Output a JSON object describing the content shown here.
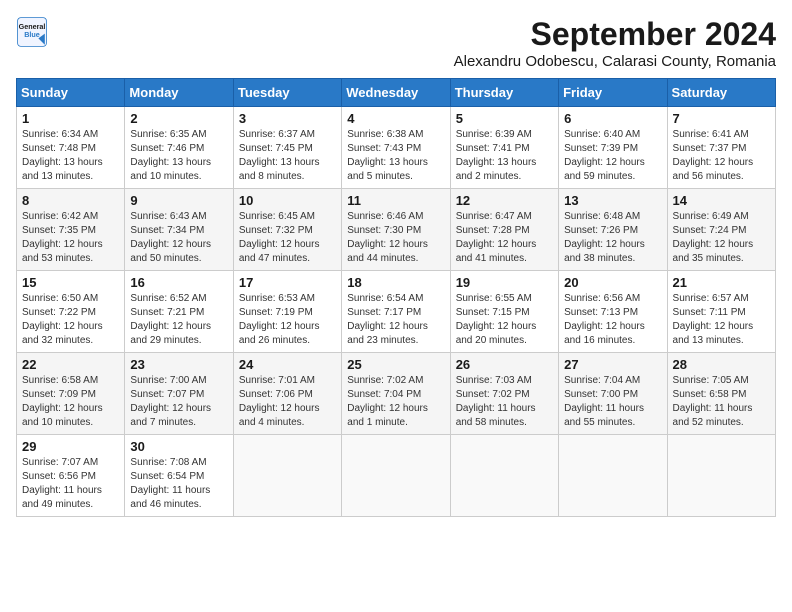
{
  "logo": {
    "line1": "General",
    "line2": "Blue"
  },
  "title": "September 2024",
  "subtitle": "Alexandru Odobescu, Calarasi County, Romania",
  "days_of_week": [
    "Sunday",
    "Monday",
    "Tuesday",
    "Wednesday",
    "Thursday",
    "Friday",
    "Saturday"
  ],
  "weeks": [
    [
      {
        "day": "1",
        "info": "Sunrise: 6:34 AM\nSunset: 7:48 PM\nDaylight: 13 hours\nand 13 minutes."
      },
      {
        "day": "2",
        "info": "Sunrise: 6:35 AM\nSunset: 7:46 PM\nDaylight: 13 hours\nand 10 minutes."
      },
      {
        "day": "3",
        "info": "Sunrise: 6:37 AM\nSunset: 7:45 PM\nDaylight: 13 hours\nand 8 minutes."
      },
      {
        "day": "4",
        "info": "Sunrise: 6:38 AM\nSunset: 7:43 PM\nDaylight: 13 hours\nand 5 minutes."
      },
      {
        "day": "5",
        "info": "Sunrise: 6:39 AM\nSunset: 7:41 PM\nDaylight: 13 hours\nand 2 minutes."
      },
      {
        "day": "6",
        "info": "Sunrise: 6:40 AM\nSunset: 7:39 PM\nDaylight: 12 hours\nand 59 minutes."
      },
      {
        "day": "7",
        "info": "Sunrise: 6:41 AM\nSunset: 7:37 PM\nDaylight: 12 hours\nand 56 minutes."
      }
    ],
    [
      {
        "day": "8",
        "info": "Sunrise: 6:42 AM\nSunset: 7:35 PM\nDaylight: 12 hours\nand 53 minutes."
      },
      {
        "day": "9",
        "info": "Sunrise: 6:43 AM\nSunset: 7:34 PM\nDaylight: 12 hours\nand 50 minutes."
      },
      {
        "day": "10",
        "info": "Sunrise: 6:45 AM\nSunset: 7:32 PM\nDaylight: 12 hours\nand 47 minutes."
      },
      {
        "day": "11",
        "info": "Sunrise: 6:46 AM\nSunset: 7:30 PM\nDaylight: 12 hours\nand 44 minutes."
      },
      {
        "day": "12",
        "info": "Sunrise: 6:47 AM\nSunset: 7:28 PM\nDaylight: 12 hours\nand 41 minutes."
      },
      {
        "day": "13",
        "info": "Sunrise: 6:48 AM\nSunset: 7:26 PM\nDaylight: 12 hours\nand 38 minutes."
      },
      {
        "day": "14",
        "info": "Sunrise: 6:49 AM\nSunset: 7:24 PM\nDaylight: 12 hours\nand 35 minutes."
      }
    ],
    [
      {
        "day": "15",
        "info": "Sunrise: 6:50 AM\nSunset: 7:22 PM\nDaylight: 12 hours\nand 32 minutes."
      },
      {
        "day": "16",
        "info": "Sunrise: 6:52 AM\nSunset: 7:21 PM\nDaylight: 12 hours\nand 29 minutes."
      },
      {
        "day": "17",
        "info": "Sunrise: 6:53 AM\nSunset: 7:19 PM\nDaylight: 12 hours\nand 26 minutes."
      },
      {
        "day": "18",
        "info": "Sunrise: 6:54 AM\nSunset: 7:17 PM\nDaylight: 12 hours\nand 23 minutes."
      },
      {
        "day": "19",
        "info": "Sunrise: 6:55 AM\nSunset: 7:15 PM\nDaylight: 12 hours\nand 20 minutes."
      },
      {
        "day": "20",
        "info": "Sunrise: 6:56 AM\nSunset: 7:13 PM\nDaylight: 12 hours\nand 16 minutes."
      },
      {
        "day": "21",
        "info": "Sunrise: 6:57 AM\nSunset: 7:11 PM\nDaylight: 12 hours\nand 13 minutes."
      }
    ],
    [
      {
        "day": "22",
        "info": "Sunrise: 6:58 AM\nSunset: 7:09 PM\nDaylight: 12 hours\nand 10 minutes."
      },
      {
        "day": "23",
        "info": "Sunrise: 7:00 AM\nSunset: 7:07 PM\nDaylight: 12 hours\nand 7 minutes."
      },
      {
        "day": "24",
        "info": "Sunrise: 7:01 AM\nSunset: 7:06 PM\nDaylight: 12 hours\nand 4 minutes."
      },
      {
        "day": "25",
        "info": "Sunrise: 7:02 AM\nSunset: 7:04 PM\nDaylight: 12 hours\nand 1 minute."
      },
      {
        "day": "26",
        "info": "Sunrise: 7:03 AM\nSunset: 7:02 PM\nDaylight: 11 hours\nand 58 minutes."
      },
      {
        "day": "27",
        "info": "Sunrise: 7:04 AM\nSunset: 7:00 PM\nDaylight: 11 hours\nand 55 minutes."
      },
      {
        "day": "28",
        "info": "Sunrise: 7:05 AM\nSunset: 6:58 PM\nDaylight: 11 hours\nand 52 minutes."
      }
    ],
    [
      {
        "day": "29",
        "info": "Sunrise: 7:07 AM\nSunset: 6:56 PM\nDaylight: 11 hours\nand 49 minutes."
      },
      {
        "day": "30",
        "info": "Sunrise: 7:08 AM\nSunset: 6:54 PM\nDaylight: 11 hours\nand 46 minutes."
      },
      {
        "day": "",
        "info": ""
      },
      {
        "day": "",
        "info": ""
      },
      {
        "day": "",
        "info": ""
      },
      {
        "day": "",
        "info": ""
      },
      {
        "day": "",
        "info": ""
      }
    ]
  ]
}
